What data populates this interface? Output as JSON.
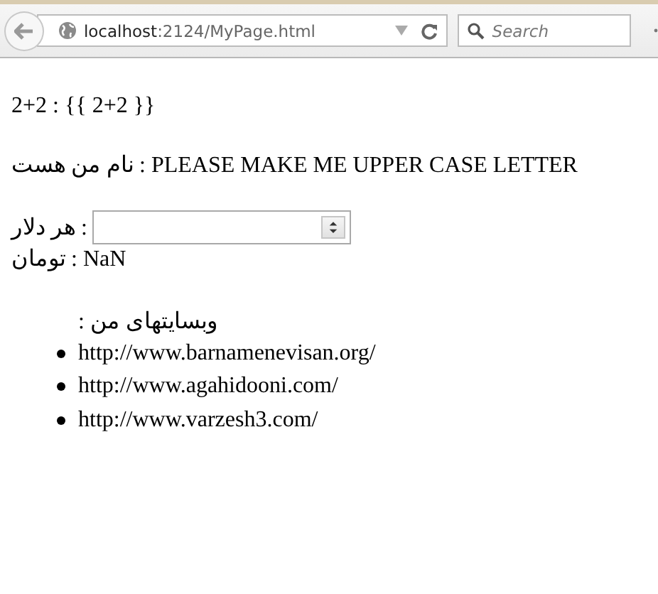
{
  "browser": {
    "address": {
      "host": "localhost",
      "path": ":2124/MyPage.html"
    },
    "search": {
      "placeholder": "Search"
    }
  },
  "page": {
    "expression_line": "2+2 : {{ 2+2 }}",
    "name_line": "نام من هست : PLEASE MAKE ME UPPER CASE LETTER",
    "dollar_field": {
      "label": "هر دلار :"
    },
    "toman_line": "تومان : NaN",
    "sites": {
      "heading": "وبسایتهای من :",
      "items": [
        "http://www.barnamenevisan.org/",
        "http://www.agahidooni.com/",
        "http://www.varzesh3.com/"
      ]
    }
  }
}
